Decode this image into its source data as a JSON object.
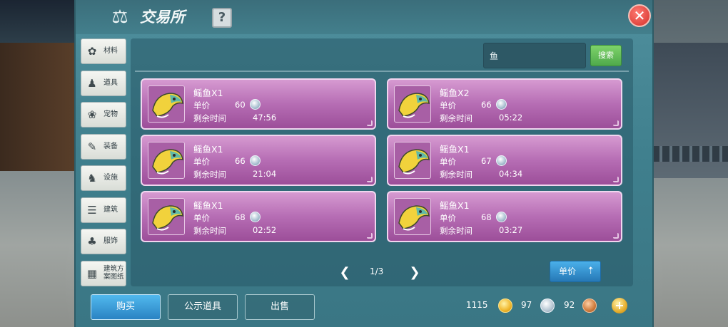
{
  "window": {
    "title": "交易所",
    "help_label": "?",
    "close_label": "✕"
  },
  "sidebar": {
    "items": [
      {
        "label": "材料",
        "icon": "materials-icon",
        "glyph": "✿"
      },
      {
        "label": "道具",
        "icon": "tools-icon",
        "glyph": "♟"
      },
      {
        "label": "宠物",
        "icon": "pet-paw-icon",
        "glyph": "❀"
      },
      {
        "label": "装备",
        "icon": "equipment-icon",
        "glyph": "✎"
      },
      {
        "label": "设施",
        "icon": "facility-icon",
        "glyph": "♞"
      },
      {
        "label": "建筑",
        "icon": "building-icon",
        "glyph": "☰"
      },
      {
        "label": "服饰",
        "icon": "clothing-icon",
        "glyph": "♣"
      },
      {
        "label": "建筑方案图纸",
        "icon": "blueprint-icon",
        "glyph": "▦"
      }
    ]
  },
  "search": {
    "value": "鱼",
    "button_label": "搜索"
  },
  "listings": [
    {
      "name": "鳐鱼X1",
      "price_label": "单价",
      "price": "60",
      "time_label": "剩余时间",
      "time_left": "47:56"
    },
    {
      "name": "鳐鱼X2",
      "price_label": "单价",
      "price": "66",
      "time_label": "剩余时间",
      "time_left": "05:22"
    },
    {
      "name": "鳐鱼X1",
      "price_label": "单价",
      "price": "66",
      "time_label": "剩余时间",
      "time_left": "21:04"
    },
    {
      "name": "鳐鱼X1",
      "price_label": "单价",
      "price": "67",
      "time_label": "剩余时间",
      "time_left": "04:34"
    },
    {
      "name": "鳐鱼X1",
      "price_label": "单价",
      "price": "68",
      "time_label": "剩余时间",
      "time_left": "02:52"
    },
    {
      "name": "鳐鱼X1",
      "price_label": "单价",
      "price": "68",
      "time_label": "剩余时间",
      "time_left": "03:27"
    }
  ],
  "pagination": {
    "current": "1/3",
    "prev": "❮",
    "next": "❯"
  },
  "sort": {
    "label": "单价",
    "arrow": "⇡"
  },
  "tabs": {
    "buy": "购买",
    "public": "公示道具",
    "sell": "出售"
  },
  "currency": {
    "gold": "1115",
    "silver": "97",
    "copper": "92",
    "add": "+"
  },
  "colors": {
    "panel": "#4a8796",
    "card": "#b66db4",
    "active_tab": "#3a9bd7",
    "search_button": "#5fbc56",
    "close_button": "#e0403a"
  }
}
